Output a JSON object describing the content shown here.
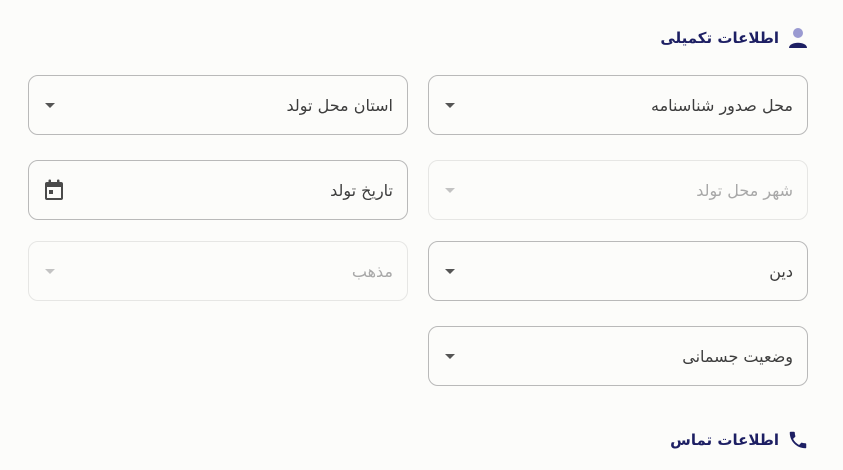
{
  "supplementary": {
    "title": "اطلاعات تکمیلی",
    "icon": "person-icon",
    "fields": [
      {
        "label": "محل صدور شناسنامه",
        "type": "select",
        "disabled": false
      },
      {
        "label": "استان محل تولد",
        "type": "select",
        "disabled": false
      },
      {
        "label": "شهر محل تولد",
        "type": "select",
        "disabled": true
      },
      {
        "label": "تاریخ تولد",
        "type": "date",
        "disabled": false
      },
      {
        "label": "دین",
        "type": "select",
        "disabled": false
      },
      {
        "label": "مذهب",
        "type": "select",
        "disabled": true
      },
      {
        "label": "وضعیت جسمانی",
        "type": "select",
        "disabled": false
      }
    ]
  },
  "contact": {
    "title": "اطلاعات تماس",
    "icon": "phone-icon"
  },
  "colors": {
    "accent": "#1d1f63",
    "icon_muted": "#9a9ad1",
    "border": "#b9b9b9",
    "border_disabled": "#e6e6e4"
  }
}
